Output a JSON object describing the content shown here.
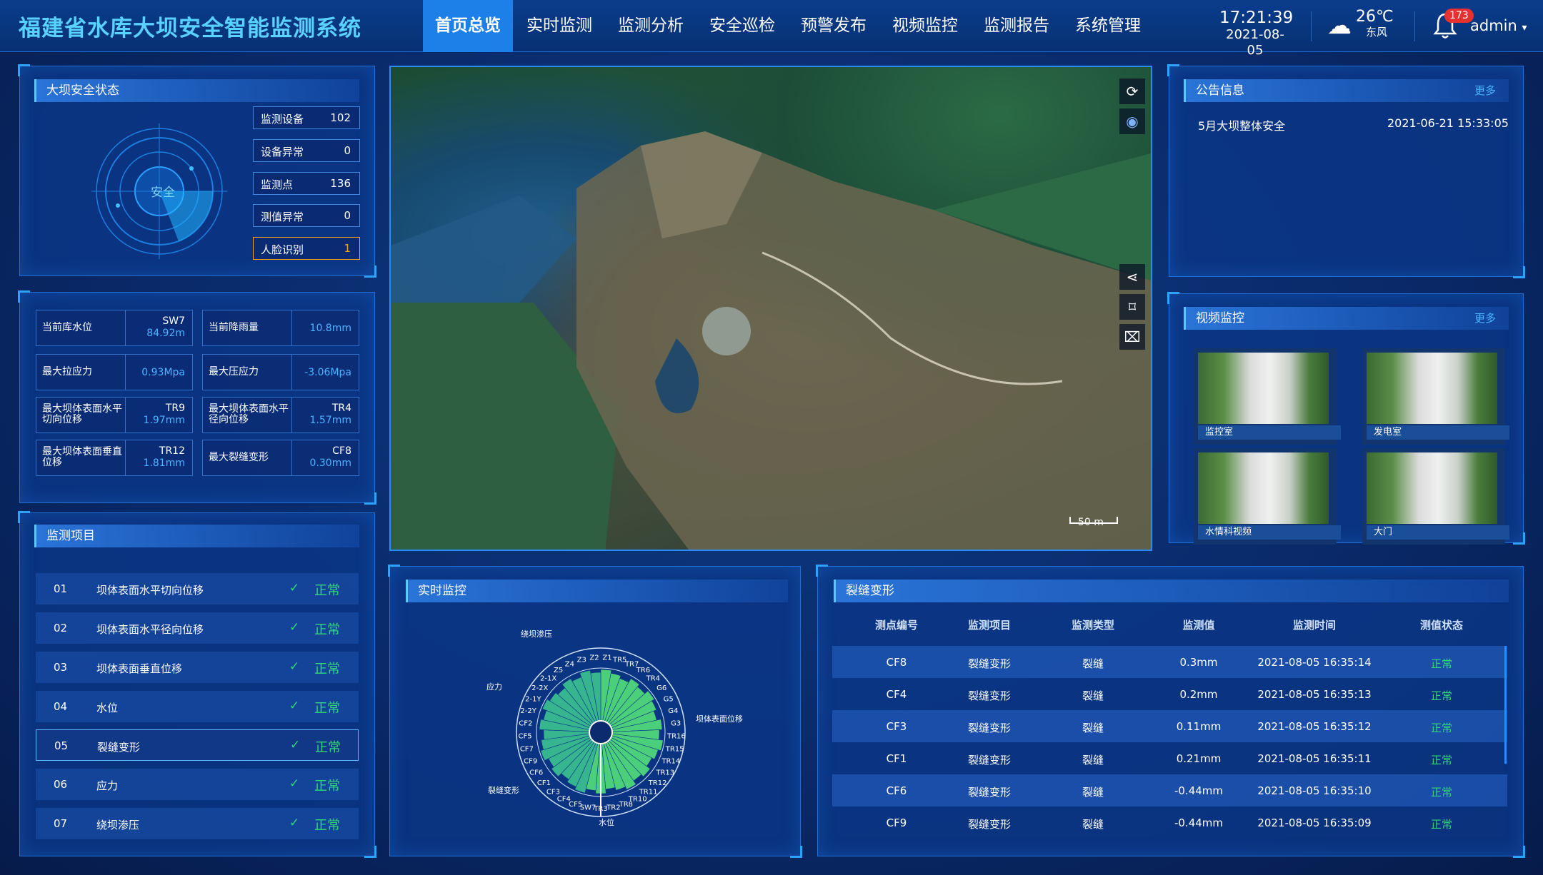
{
  "header": {
    "title": "福建省水库大坝安全智能监测系统",
    "nav": [
      "首页总览",
      "实时监测",
      "监测分析",
      "安全巡检",
      "预警发布",
      "视频监控",
      "监测报告",
      "系统管理"
    ],
    "time": "17:21:39",
    "date": "2021-08-05",
    "temp": "26℃",
    "wind": "东风",
    "notif_count": "173",
    "user": "admin"
  },
  "dam_status": {
    "title": "大坝安全状态",
    "radar_label": "安全",
    "stats": [
      {
        "label": "监测设备",
        "value": "102"
      },
      {
        "label": "设备异常",
        "value": "0"
      },
      {
        "label": "监测点",
        "value": "136"
      },
      {
        "label": "测值异常",
        "value": "0"
      },
      {
        "label": "人脸识别",
        "value": "1"
      }
    ]
  },
  "metrics": [
    {
      "label": "当前库水位",
      "code": "SW7",
      "value": "84.92m"
    },
    {
      "label": "当前降雨量",
      "code": "",
      "value": "10.8mm"
    },
    {
      "label": "最大拉应力",
      "code": "",
      "value": "0.93Mpa"
    },
    {
      "label": "最大压应力",
      "code": "",
      "value": "-3.06Mpa"
    },
    {
      "label": "最大坝体表面水平切向位移",
      "code": "TR9",
      "value": "1.97mm"
    },
    {
      "label": "最大坝体表面水平径向位移",
      "code": "TR4",
      "value": "1.57mm"
    },
    {
      "label": "最大坝体表面垂直位移",
      "code": "TR12",
      "value": "1.81mm"
    },
    {
      "label": "最大裂缝变形",
      "code": "CF8",
      "value": "0.30mm"
    }
  ],
  "monitor_items": {
    "title": "监测项目",
    "items": [
      {
        "no": "01",
        "label": "坝体表面水平切向位移",
        "status": "正常"
      },
      {
        "no": "02",
        "label": "坝体表面水平径向位移",
        "status": "正常"
      },
      {
        "no": "03",
        "label": "坝体表面垂直位移",
        "status": "正常"
      },
      {
        "no": "04",
        "label": "水位",
        "status": "正常"
      },
      {
        "no": "05",
        "label": "裂缝变形",
        "status": "正常"
      },
      {
        "no": "06",
        "label": "应力",
        "status": "正常"
      },
      {
        "no": "07",
        "label": "绕坝渗压",
        "status": "正常"
      }
    ]
  },
  "map": {
    "scale": "50 m"
  },
  "notice": {
    "title": "公告信息",
    "more": "更多",
    "items": [
      {
        "text": "5月大坝整体安全",
        "time": "2021-06-21 15:33:05"
      }
    ]
  },
  "video": {
    "title": "视频监控",
    "more": "更多",
    "cams": [
      "监控室",
      "发电室",
      "水情科视频",
      "大门"
    ]
  },
  "realtime": {
    "title": "实时监控",
    "group_labels": [
      "绕坝渗压",
      "应力",
      "坝体表面位移",
      "裂缝变形",
      "水位"
    ],
    "sector_labels": [
      "Z1",
      "TR5",
      "TR7",
      "TR6",
      "TR4",
      "G6",
      "G5",
      "G4",
      "G3",
      "TR16",
      "TR15",
      "TR14",
      "TR13",
      "TR12",
      "TR11",
      "TR10",
      "TR8",
      "TR2",
      "TR3",
      "SW7",
      "CF5",
      "CF4",
      "CF3",
      "CF1",
      "CF6",
      "CF9",
      "CF7",
      "CF5",
      "CF2",
      "2-2Y",
      "2-1Y",
      "2-2X",
      "2-1X",
      "Z5",
      "Z4",
      "Z3",
      "Z2"
    ]
  },
  "crack": {
    "title": "裂缝变形",
    "headers": [
      "测点编号",
      "监测项目",
      "监测类型",
      "监测值",
      "监测时间",
      "测值状态"
    ],
    "rows": [
      [
        "CF8",
        "裂缝变形",
        "裂缝",
        "0.3mm",
        "2021-08-05 16:35:14",
        "正常"
      ],
      [
        "CF4",
        "裂缝变形",
        "裂缝",
        "0.2mm",
        "2021-08-05 16:35:13",
        "正常"
      ],
      [
        "CF3",
        "裂缝变形",
        "裂缝",
        "0.11mm",
        "2021-08-05 16:35:12",
        "正常"
      ],
      [
        "CF1",
        "裂缝变形",
        "裂缝",
        "0.21mm",
        "2021-08-05 16:35:11",
        "正常"
      ],
      [
        "CF6",
        "裂缝变形",
        "裂缝",
        "-0.44mm",
        "2021-08-05 16:35:10",
        "正常"
      ],
      [
        "CF9",
        "裂缝变形",
        "裂缝",
        "-0.44mm",
        "2021-08-05 16:35:09",
        "正常"
      ]
    ]
  }
}
